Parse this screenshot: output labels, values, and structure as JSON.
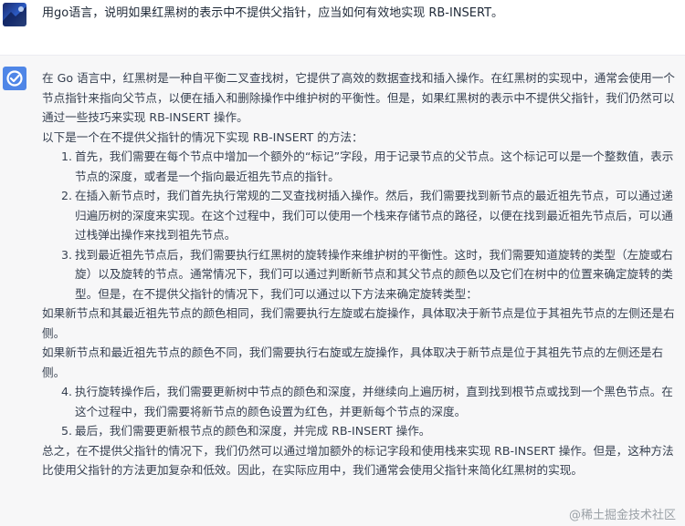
{
  "user_message": {
    "text": "用go语言，说明如果红黑树的表示中不提供父指针，应当如何有效地实现 RB-INSERT。"
  },
  "assistant_message": {
    "intro": "在 Go 语言中，红黑树是一种自平衡二叉查找树，它提供了高效的数据查找和插入操作。在红黑树的实现中，通常会使用一个节点指针来指向父节点，以便在插入和删除操作中维护树的平衡性。但是，如果红黑树的表示中不提供父指针，我们仍然可以通过一些技巧来实现 RB-INSERT 操作。",
    "lead": "以下是一个在不提供父指针的情况下实现 RB-INSERT 的方法：",
    "steps_a": [
      {
        "num": "1.",
        "text": "首先，我们需要在每个节点中增加一个额外的“标记”字段，用于记录节点的父节点。这个标记可以是一个整数值，表示节点的深度，或者是一个指向最近祖先节点的指针。"
      },
      {
        "num": "2.",
        "text": "在插入新节点时，我们首先执行常规的二叉查找树插入操作。然后，我们需要找到新节点的最近祖先节点，可以通过递归遍历树的深度来实现。在这个过程中，我们可以使用一个栈来存储节点的路径，以便在找到最近祖先节点后，可以通过栈弹出操作来找到祖先节点。"
      },
      {
        "num": "3.",
        "text": "找到最近祖先节点后，我们需要执行红黑树的旋转操作来维护树的平衡性。这时，我们需要知道旋转的类型（左旋或右旋）以及旋转的节点。通常情况下，我们可以通过判断新节点和其父节点的颜色以及它们在树中的位置来确定旋转的类型。但是，在不提供父指针的情况下，我们可以通过以下方法来确定旋转类型："
      }
    ],
    "para_same": "如果新节点和其最近祖先节点的颜色相同，我们需要执行左旋或右旋操作，具体取决于新节点是位于其祖先节点的左侧还是右侧。",
    "para_diff": "如果新节点和最近祖先节点的颜色不同，我们需要执行右旋或左旋操作，具体取决于新节点是位于其祖先节点的左侧还是右侧。",
    "steps_b": [
      {
        "num": "4.",
        "text": "执行旋转操作后，我们需要更新树中节点的颜色和深度，并继续向上遍历树，直到找到根节点或找到一个黑色节点。在这个过程中，我们需要将新节点的颜色设置为红色，并更新每个节点的深度。"
      },
      {
        "num": "5.",
        "text": "最后，我们需要更新根节点的颜色和深度，并完成 RB-INSERT 操作。"
      }
    ],
    "conclusion": "总之，在不提供父指针的情况下，我们仍然可以通过增加额外的标记字段和使用栈来实现 RB-INSERT 操作。但是，这种方法比使用父指针的方法更加复杂和低效。因此，在实际应用中，我们通常会使用父指针来简化红黑树的实现。"
  },
  "watermark": "@稀土掘金技术社区",
  "colors": {
    "bot_avatar": "#4f86e7",
    "bot_bg": "#f7f7f8",
    "text": "#374151"
  }
}
